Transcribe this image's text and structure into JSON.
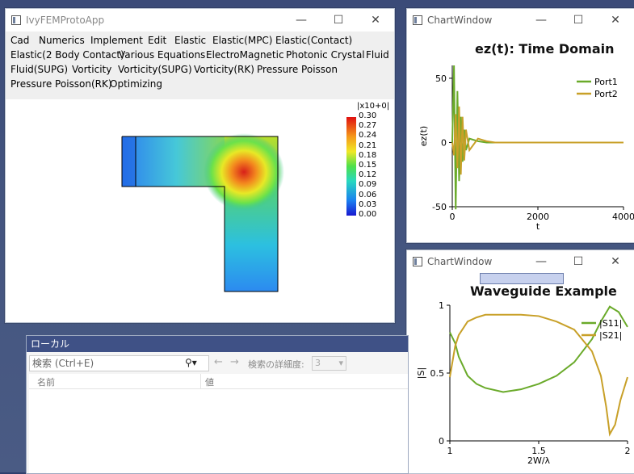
{
  "main_window": {
    "title": "IvyFEMProtoApp",
    "menu": [
      "Cad",
      "Numerics",
      "Implement",
      "Edit",
      "Elastic",
      "Elastic(MPC)",
      "Elastic(Contact)",
      "Elastic(2 Body Contact)",
      "Various Equations",
      "ElectroMagnetic",
      "Photonic Crystal",
      "Fluid",
      "Fluid(SUPG)",
      "Vorticity",
      "Vorticity(SUPG)",
      "Vorticity(RK)",
      "Pressure Poisson",
      "Pressure Poisson(RK)",
      "Optimizing"
    ],
    "colorbar": {
      "exponent": "|x10+0|",
      "ticks": [
        "0.30",
        "0.27",
        "0.24",
        "0.21",
        "0.18",
        "0.15",
        "0.12",
        "0.09",
        "0.06",
        "0.03",
        "0.00"
      ]
    }
  },
  "window_controls": {
    "minimize": "—",
    "maximize": "☐",
    "close": "✕"
  },
  "chart_window_1": {
    "title": "ChartWindow"
  },
  "chart_window_2": {
    "title": "ChartWindow"
  },
  "local_panel": {
    "title": "ローカル",
    "search_placeholder": "検索 (Ctrl+E)",
    "search_icon": "search-icon",
    "nav_back": "←",
    "nav_forward": "→",
    "depth_label": "検索の詳細度:",
    "depth_value": "3",
    "col_name": "名前",
    "col_value": "値"
  },
  "chart_data": [
    {
      "type": "line",
      "title": "ez(t): Time Domain",
      "xlabel": "t",
      "ylabel": "ez(t)",
      "xlim": [
        0,
        4000
      ],
      "ylim": [
        -50,
        60
      ],
      "xticks": [
        "0",
        "2000",
        "4000"
      ],
      "yticks": [
        "50",
        "0",
        "-50"
      ],
      "legend": "top-right",
      "series": [
        {
          "name": "Port1",
          "color": "#6aaa2a",
          "x": [
            0,
            40,
            80,
            120,
            160,
            200,
            240,
            280,
            320,
            400,
            600,
            800,
            1000,
            1500,
            2000,
            3000,
            4000
          ],
          "values": [
            0,
            60,
            -52,
            40,
            -30,
            20,
            -15,
            10,
            -6,
            3,
            1,
            0,
            0,
            0,
            0,
            0,
            0
          ]
        },
        {
          "name": "Port2",
          "color": "#c8a028",
          "x": [
            0,
            40,
            80,
            120,
            160,
            200,
            240,
            280,
            320,
            400,
            600,
            800,
            1000,
            1500,
            2000,
            3000,
            4000
          ],
          "values": [
            0,
            -10,
            22,
            -20,
            28,
            -25,
            20,
            -14,
            10,
            -6,
            3,
            1,
            0,
            0,
            0,
            0,
            0
          ]
        }
      ]
    },
    {
      "type": "line",
      "title": "Waveguide Example",
      "xlabel": "2W/λ",
      "ylabel": "|S|",
      "xlim": [
        1,
        2
      ],
      "ylim": [
        0,
        1
      ],
      "xticks": [
        "1",
        "1.5",
        "2"
      ],
      "yticks": [
        "1",
        "0.5",
        "0"
      ],
      "legend": "top-right",
      "series": [
        {
          "name": "|S11|",
          "color": "#6aaa2a",
          "x": [
            1.0,
            1.03,
            1.05,
            1.1,
            1.15,
            1.2,
            1.3,
            1.4,
            1.5,
            1.6,
            1.7,
            1.8,
            1.85,
            1.9,
            1.95,
            2.0
          ],
          "values": [
            0.8,
            0.72,
            0.62,
            0.48,
            0.42,
            0.39,
            0.36,
            0.38,
            0.42,
            0.48,
            0.58,
            0.75,
            0.88,
            0.99,
            0.95,
            0.84
          ]
        },
        {
          "name": "|S21|",
          "color": "#c8a028",
          "x": [
            1.0,
            1.03,
            1.05,
            1.1,
            1.15,
            1.2,
            1.3,
            1.4,
            1.5,
            1.6,
            1.7,
            1.8,
            1.85,
            1.88,
            1.9,
            1.93,
            1.96,
            2.0
          ],
          "values": [
            0.47,
            0.7,
            0.78,
            0.88,
            0.91,
            0.93,
            0.93,
            0.93,
            0.92,
            0.88,
            0.82,
            0.66,
            0.48,
            0.25,
            0.05,
            0.12,
            0.3,
            0.47
          ]
        }
      ]
    }
  ]
}
